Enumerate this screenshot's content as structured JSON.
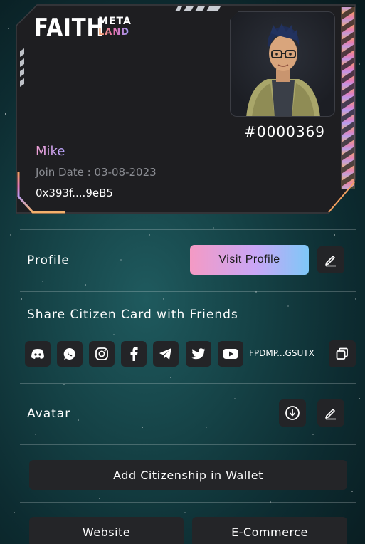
{
  "card": {
    "logo_main": "FAITH",
    "logo_meta": "META",
    "logo_land": "LAND",
    "citizen_id": "#0000369",
    "user_name": "Mike",
    "join_date": "Join Date : 03-08-2023",
    "wallet": "0x393f....9eB5"
  },
  "profile": {
    "label": "Profile",
    "visit_button": "Visit Profile"
  },
  "share": {
    "label": "Share Citizen Card with Friends",
    "icons": [
      "discord-icon",
      "whatsapp-icon",
      "instagram-icon",
      "facebook-icon",
      "telegram-icon",
      "twitter-icon",
      "youtube-icon"
    ],
    "referral_code": "FPDMP...GSUTX"
  },
  "avatar_section": {
    "label": "Avatar"
  },
  "wallet_button": "Add Citizenship in Wallet",
  "bottom_buttons": {
    "website": "Website",
    "ecommerce": "E-Commerce"
  },
  "colors": {
    "card_bg": "#1e1e21",
    "button_bg": "#232427",
    "accent_pink": "#f49ac4",
    "accent_blue": "#7ec8f7"
  }
}
